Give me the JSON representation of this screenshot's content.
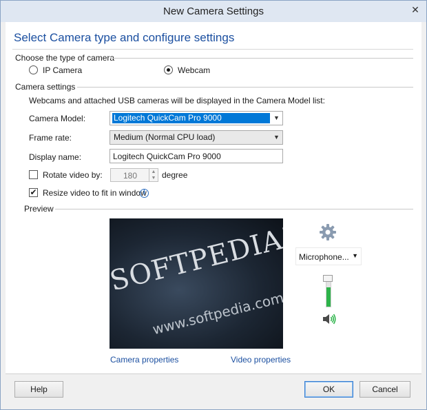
{
  "window": {
    "title": "New Camera Settings",
    "close_glyph": "✕"
  },
  "heading": "Select Camera type and configure settings",
  "camera_type": {
    "group_title": "Choose the type of camera",
    "options": [
      {
        "label": "IP Camera",
        "selected": false
      },
      {
        "label": "Webcam",
        "selected": true
      }
    ]
  },
  "camera_settings": {
    "group_title": "Camera settings",
    "note": "Webcams and attached USB cameras will be displayed in the Camera Model list:",
    "camera_model": {
      "label": "Camera Model:",
      "value": "Logitech QuickCam Pro 9000"
    },
    "frame_rate": {
      "label": "Frame rate:",
      "value": "Medium (Normal CPU load)"
    },
    "display_name": {
      "label": "Display name:",
      "value": "Logitech QuickCam Pro 9000"
    },
    "rotate": {
      "label": "Rotate video by:",
      "checked": false,
      "value": "180",
      "unit": "degree"
    },
    "resize": {
      "label": "Resize video to fit in window",
      "checked": true,
      "info_icon": "info-icon"
    }
  },
  "preview": {
    "group_title": "Preview",
    "watermark_main": "SOFTPEDIA™",
    "watermark_url": "www.softpedia.com",
    "camera_properties_link": "Camera properties",
    "video_properties_link": "Video properties",
    "microphone_label": "Microphone...",
    "volume_level": 0.7,
    "icons": [
      "gear-icon",
      "speaker-icon",
      "chevron-down-icon"
    ]
  },
  "footer": {
    "help": "Help",
    "ok": "OK",
    "cancel": "Cancel"
  },
  "colors": {
    "accent": "#1b4fa0",
    "selection": "#0078d7",
    "volume": "#2db34a"
  }
}
